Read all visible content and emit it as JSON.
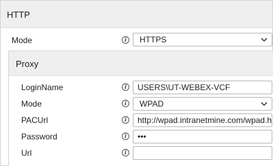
{
  "http_section": {
    "title": "HTTP",
    "mode": {
      "label": "Mode",
      "value": "HTTPS",
      "info_icon": "info-icon"
    }
  },
  "proxy_section": {
    "title": "Proxy",
    "login_name": {
      "label": "LoginName",
      "value": "USERS\\UT-WEBEX-VCF"
    },
    "mode": {
      "label": "Mode",
      "value": "WPAD"
    },
    "pac_url": {
      "label": "PACUrl",
      "value": "http://wpad.intranetmine.com/wpad.htm"
    },
    "password": {
      "label": "Password",
      "value": "•••"
    },
    "url": {
      "label": "Url",
      "value": ""
    }
  },
  "icons": {
    "info": "info-icon",
    "dropdown": "chevron-down-icon"
  }
}
